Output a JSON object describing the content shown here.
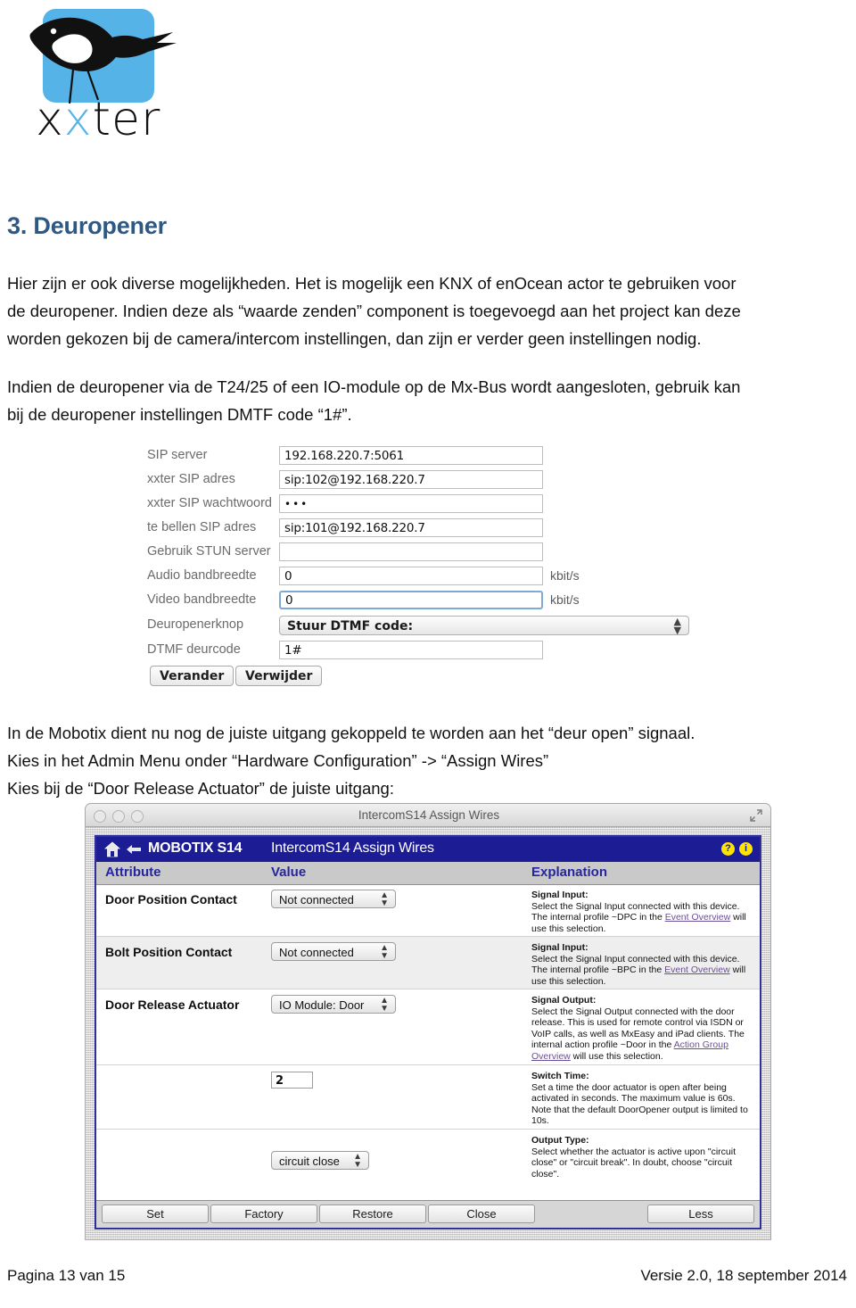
{
  "logo": {
    "wordmark_part1": "x",
    "wordmark_part2": "x",
    "wordmark_part3": "ter"
  },
  "document": {
    "heading": "3. Deuropener",
    "paragraph1_line1": "Hier zijn er ook diverse mogelijkheden. Het is mogelijk een KNX of enOcean actor te gebruiken voor",
    "paragraph1_line2": "de deuropener. Indien deze als “waarde zenden” component is toegevoegd aan het project kan deze",
    "paragraph1_line3": "worden gekozen bij de camera/intercom instellingen, dan zijn er verder geen instellingen nodig.",
    "paragraph2_line1": "Indien de deuropener via de T24/25 of een IO-module op de Mx-Bus wordt aangesloten, gebruik kan",
    "paragraph2_line2": "bij de deuropener instellingen DMTF code “1#”.",
    "paragraph3_line1": "In de Mobotix dient nu nog de juiste uitgang gekoppeld te worden aan het “deur open” signaal.",
    "paragraph3_line2": "Kies in het Admin Menu onder “Hardware Configuration” -> “Assign Wires”",
    "paragraph3_line3": "Kies bij de “Door Release Actuator” de juiste uitgang:"
  },
  "sip_form": {
    "rows": [
      {
        "label": "SIP server",
        "value": "192.168.220.7:5061",
        "type": "text"
      },
      {
        "label": "xxter SIP adres",
        "value": "sip:102@192.168.220.7",
        "type": "text"
      },
      {
        "label": "xxter SIP wachtwoord",
        "value": "•••",
        "type": "password"
      },
      {
        "label": "te bellen SIP adres",
        "value": "sip:101@192.168.220.7",
        "type": "text"
      },
      {
        "label": "Gebruik STUN server",
        "value": "",
        "type": "text"
      },
      {
        "label": "Audio bandbreedte",
        "value": "0",
        "unit": "kbit/s",
        "type": "text"
      },
      {
        "label": "Video bandbreedte",
        "value": "0",
        "unit": "kbit/s",
        "type": "text",
        "focused": true
      },
      {
        "label": "Deuropenerknop",
        "value": "Stuur DTMF code:",
        "type": "select"
      },
      {
        "label": "DTMF deurcode",
        "value": "1#",
        "type": "text"
      }
    ],
    "buttons": {
      "change": "Verander",
      "delete": "Verwijder"
    }
  },
  "mobotix_window": {
    "window_title": "IntercomS14 Assign Wires",
    "nav": {
      "brand": "MOBOTIX S14",
      "page": "IntercomS14 Assign Wires",
      "help_icon": "?",
      "info_icon": "i"
    },
    "columns": {
      "attribute": "Attribute",
      "value": "Value",
      "explanation": "Explanation"
    },
    "rows": [
      {
        "attribute": "Door Position Contact",
        "value": "Not connected",
        "control": "dropdown",
        "explanation_title": "Signal Input:",
        "explanation_text_a": "Select the Signal Input connected with this device. The internal profile ~DPC in the ",
        "explanation_link": "Event Overview",
        "explanation_text_b": " will use this selection."
      },
      {
        "attribute": "Bolt Position Contact",
        "value": "Not connected",
        "control": "dropdown",
        "explanation_title": "Signal Input:",
        "explanation_text_a": "Select the Signal Input connected with this device. The internal profile ~BPC in the ",
        "explanation_link": "Event Overview",
        "explanation_text_b": " will use this selection."
      },
      {
        "attribute": "Door Release Actuator",
        "value": "IO Module: Door",
        "control": "dropdown",
        "explanation_title": "Signal Output:",
        "explanation_text_a": "Select the Signal Output connected with the door release. This is used for remote control via ISDN or VoIP calls, as well as MxEasy and iPad clients. The internal action profile ~Door in the ",
        "explanation_link": "Action Group Overview",
        "explanation_text_b": " will use this selection."
      },
      {
        "attribute": "",
        "value": "2",
        "control": "textbox",
        "explanation_title": "Switch Time:",
        "explanation_text_a": "Set a time the door actuator is open after being activated in seconds. The maximum value is 60s. Note that the default DoorOpener output is limited to 10s.",
        "explanation_link": "",
        "explanation_text_b": ""
      },
      {
        "attribute": "",
        "value": "circuit close",
        "control": "dropdown",
        "explanation_title": "Output Type:",
        "explanation_text_a": "Select whether the actuator is active upon \"circuit close\" or \"circuit break\". In doubt, choose \"circuit close\".",
        "explanation_link": "",
        "explanation_text_b": ""
      }
    ],
    "footer_buttons": {
      "set": "Set",
      "factory": "Factory",
      "restore": "Restore",
      "close": "Close",
      "less": "Less"
    }
  },
  "page_footer": {
    "left": "Pagina 13 van 15",
    "right": "Versie 2.0, 18 september 2014"
  },
  "colors": {
    "heading_blue": "#2e5984",
    "logo_blue": "#55b3e8",
    "mobotix_navy": "#1c1c94",
    "link_purple": "#6b4f96",
    "help_yellow": "#ffe400"
  }
}
